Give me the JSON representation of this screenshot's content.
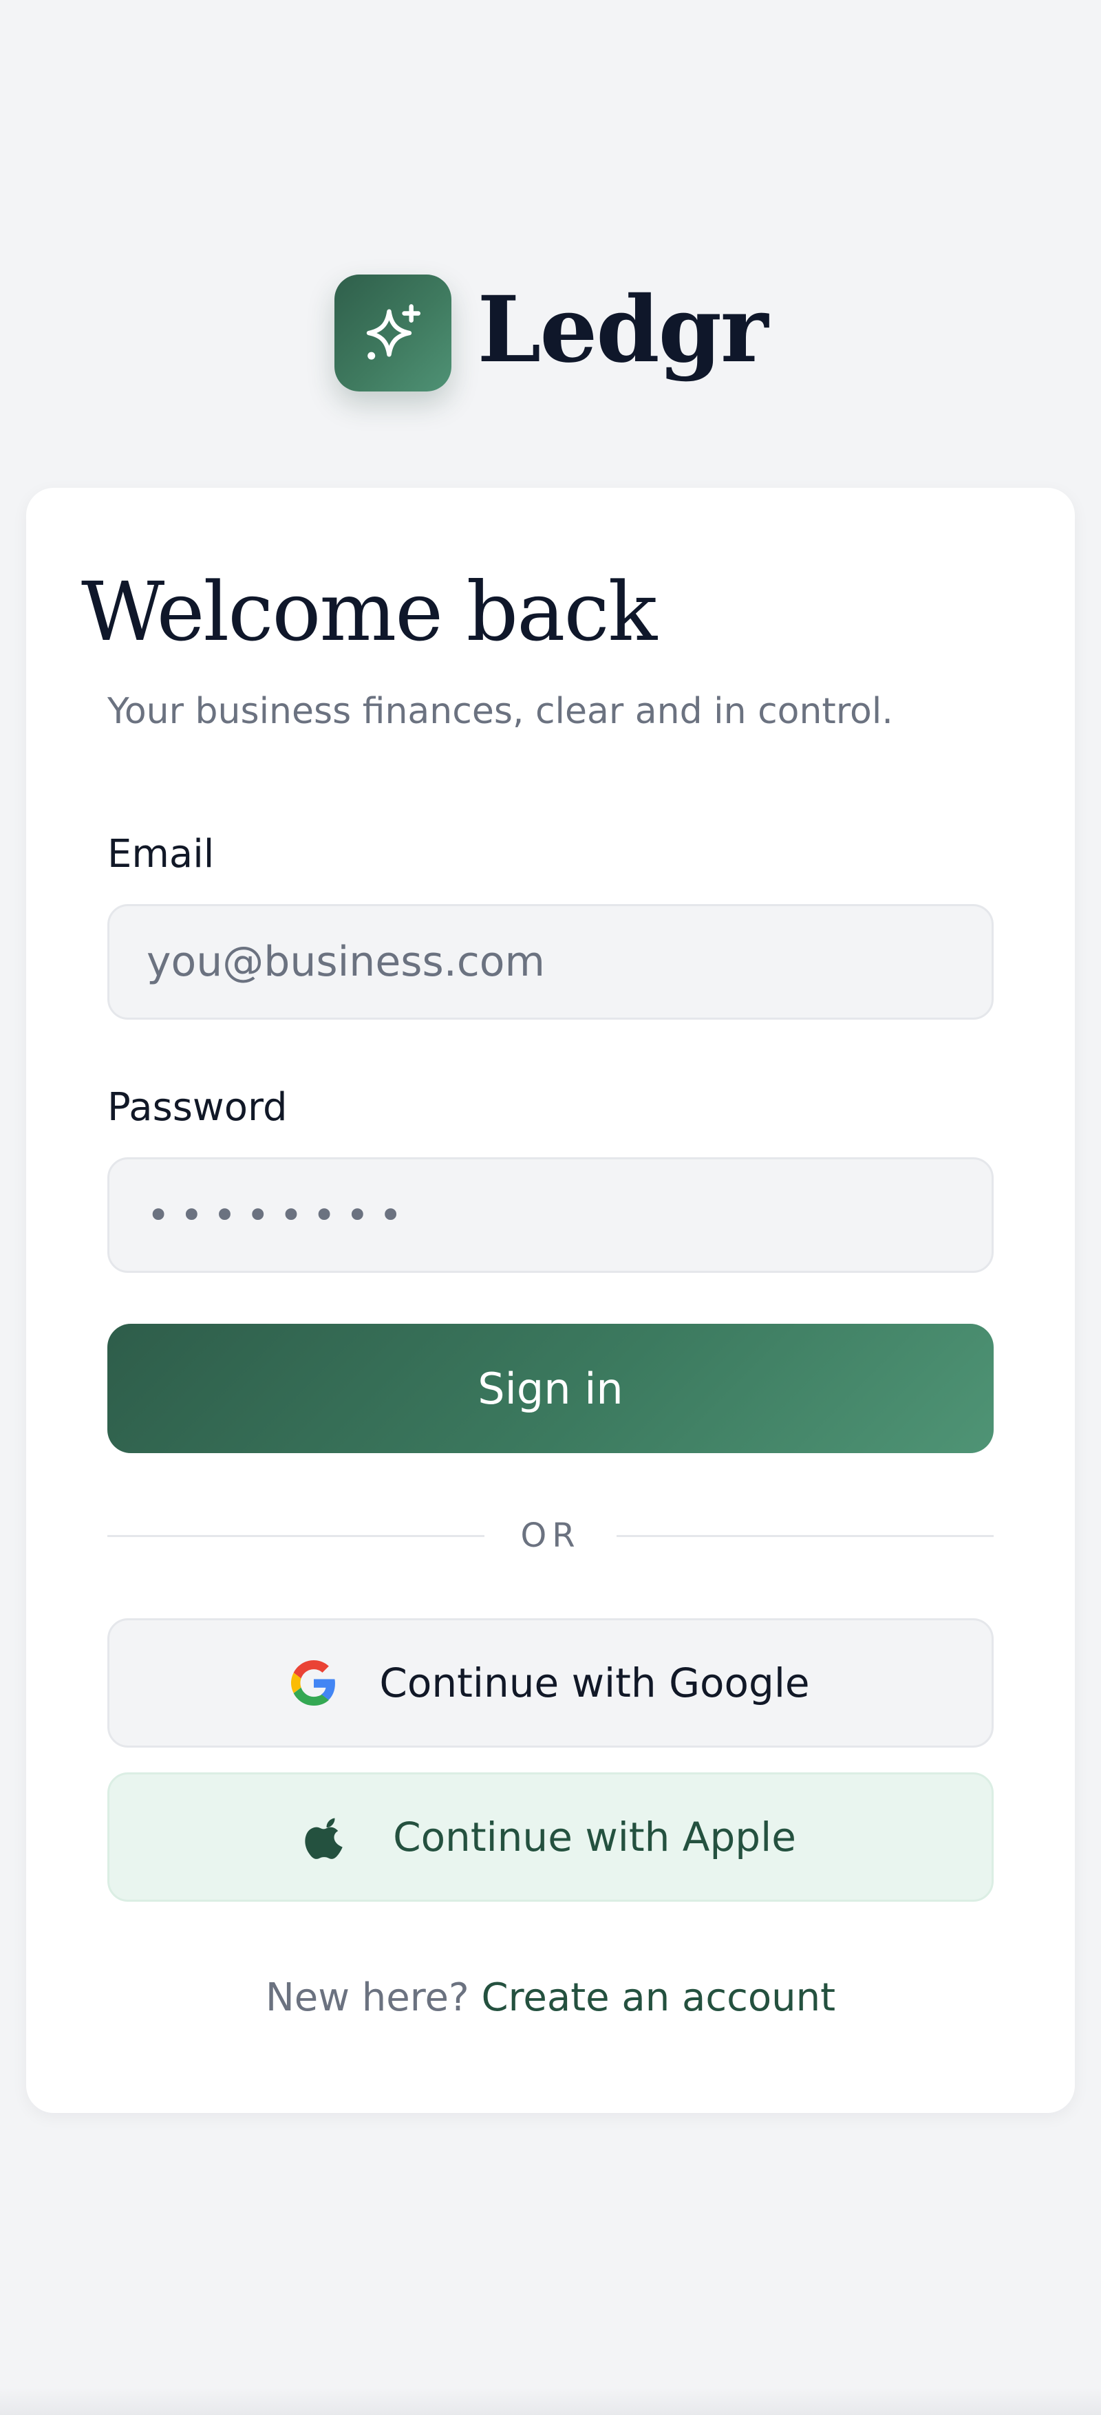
{
  "brand": {
    "name": "Ledgr",
    "logo_icon": "sparkles-icon",
    "accent_color": "#3f7a5f"
  },
  "login": {
    "title": "Welcome back",
    "subtitle": "Your business finances, clear and in control.",
    "email": {
      "label": "Email",
      "placeholder": "you@business.com",
      "value": ""
    },
    "password": {
      "label": "Password",
      "value": "••••••••"
    },
    "submit_label": "Sign in",
    "divider_label": "OR",
    "google_label": "Continue with Google",
    "apple_label": "Continue with Apple",
    "footer_prompt": "New here?",
    "footer_link": "Create an account"
  }
}
